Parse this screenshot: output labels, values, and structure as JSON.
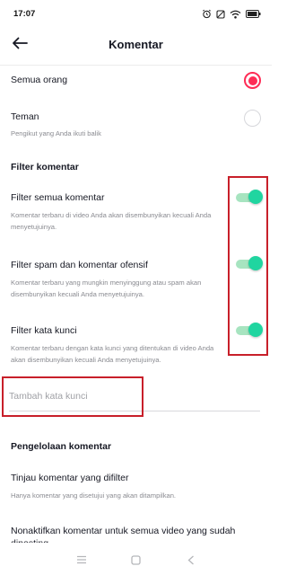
{
  "status_bar": {
    "time": "17:07",
    "icons": [
      "alarm-icon",
      "silent-icon",
      "wifi-icon",
      "battery-icon"
    ]
  },
  "header": {
    "title": "Komentar",
    "back_icon": "arrow-left-icon"
  },
  "audience": {
    "options": [
      {
        "label": "Semua orang",
        "description": "",
        "selected": true
      },
      {
        "label": "Teman",
        "description": "Pengikut yang Anda ikuti balik",
        "selected": false
      }
    ]
  },
  "filter_section": {
    "title": "Filter komentar",
    "items": [
      {
        "label": "Filter semua komentar",
        "description": "Komentar terbaru di video Anda akan disembunyikan kecuali Anda menyetujuinya.",
        "enabled": true
      },
      {
        "label": "Filter spam dan komentar ofensif",
        "description": "Komentar terbaru yang mungkin menyinggung atau spam akan disembunyikan kecuali Anda menyetujuinya.",
        "enabled": true
      },
      {
        "label": "Filter kata kunci",
        "description": "Komentar terbaru dengan kata kunci yang ditentukan di video Anda akan disembunyikan kecuali Anda menyetujuinya.",
        "enabled": true
      }
    ],
    "keyword_input": {
      "value": "",
      "placeholder": "Tambah kata kunci"
    }
  },
  "management_section": {
    "title": "Pengelolaan komentar",
    "items": [
      {
        "label": "Tinjau komentar yang difilter",
        "description": "Hanya komentar yang disetujui yang akan ditampilkan."
      },
      {
        "label": "Nonaktifkan komentar untuk semua video yang sudah diposting",
        "description": ""
      }
    ]
  },
  "colors": {
    "accent": "#fe2c55",
    "toggle_on": "#20d5a0",
    "highlight_box": "#c8202a"
  },
  "nav_bar": {
    "icons": [
      "menu-icon",
      "home-square-icon",
      "back-chevron-icon"
    ]
  }
}
